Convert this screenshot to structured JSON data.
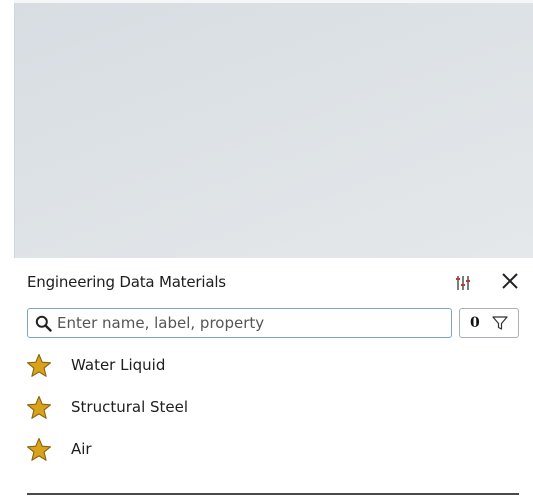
{
  "panel": {
    "title": "Engineering Data Materials"
  },
  "search": {
    "placeholder": "Enter name, label, property",
    "value": ""
  },
  "filter": {
    "count": "0"
  },
  "materials": [
    {
      "label": "Water Liquid",
      "favorite": true
    },
    {
      "label": "Structural Steel",
      "favorite": true
    },
    {
      "label": "Air",
      "favorite": true
    }
  ],
  "icons": {
    "settings": "sliders-icon",
    "close": "close-icon",
    "search": "search-icon",
    "filter": "funnel-icon",
    "favorite": "star-icon"
  },
  "colors": {
    "star_fill": "#d9a21b",
    "star_stroke": "#8a6410",
    "search_border": "#7fa4c9",
    "viewport_bg": "#dde2e6"
  }
}
